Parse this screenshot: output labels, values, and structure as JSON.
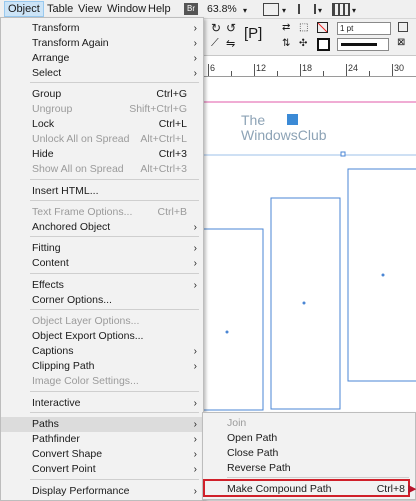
{
  "menubar": {
    "items": [
      "Object",
      "Table",
      "View",
      "Window",
      "Help"
    ],
    "zoom": "63.8%",
    "zoom_br_icon": "Br"
  },
  "controlbar": {
    "ref_label": "[P]",
    "stroke_weight": "1 pt"
  },
  "ruler": {
    "labels": [
      "6",
      "12",
      "18",
      "24",
      "30"
    ]
  },
  "watermark": {
    "line1": "The",
    "line2": "WindowsClub"
  },
  "object_menu": {
    "items": [
      {
        "label": "Transform",
        "shortcut": "",
        "submenu": true,
        "disabled": false
      },
      {
        "label": "Transform Again",
        "shortcut": "",
        "submenu": true,
        "disabled": false
      },
      {
        "label": "Arrange",
        "shortcut": "",
        "submenu": true,
        "disabled": false
      },
      {
        "label": "Select",
        "shortcut": "",
        "submenu": true,
        "disabled": false
      },
      {
        "label": "Group",
        "shortcut": "Ctrl+G",
        "submenu": false,
        "disabled": false
      },
      {
        "label": "Ungroup",
        "shortcut": "Shift+Ctrl+G",
        "submenu": false,
        "disabled": true
      },
      {
        "label": "Lock",
        "shortcut": "Ctrl+L",
        "submenu": false,
        "disabled": false
      },
      {
        "label": "Unlock All on Spread",
        "shortcut": "Alt+Ctrl+L",
        "submenu": false,
        "disabled": true
      },
      {
        "label": "Hide",
        "shortcut": "Ctrl+3",
        "submenu": false,
        "disabled": false
      },
      {
        "label": "Show All on Spread",
        "shortcut": "Alt+Ctrl+3",
        "submenu": false,
        "disabled": true
      },
      {
        "label": "Insert HTML...",
        "shortcut": "",
        "submenu": false,
        "disabled": false
      },
      {
        "label": "Text Frame Options...",
        "shortcut": "Ctrl+B",
        "submenu": false,
        "disabled": true
      },
      {
        "label": "Anchored Object",
        "shortcut": "",
        "submenu": true,
        "disabled": false
      },
      {
        "label": "Fitting",
        "shortcut": "",
        "submenu": true,
        "disabled": false
      },
      {
        "label": "Content",
        "shortcut": "",
        "submenu": true,
        "disabled": false
      },
      {
        "label": "Effects",
        "shortcut": "",
        "submenu": true,
        "disabled": false
      },
      {
        "label": "Corner Options...",
        "shortcut": "",
        "submenu": false,
        "disabled": false
      },
      {
        "label": "Object Layer Options...",
        "shortcut": "",
        "submenu": false,
        "disabled": true
      },
      {
        "label": "Object Export Options...",
        "shortcut": "",
        "submenu": false,
        "disabled": false
      },
      {
        "label": "Captions",
        "shortcut": "",
        "submenu": true,
        "disabled": false
      },
      {
        "label": "Clipping Path",
        "shortcut": "",
        "submenu": true,
        "disabled": false
      },
      {
        "label": "Image Color Settings...",
        "shortcut": "",
        "submenu": false,
        "disabled": true
      },
      {
        "label": "Interactive",
        "shortcut": "",
        "submenu": true,
        "disabled": false
      },
      {
        "label": "Paths",
        "shortcut": "",
        "submenu": true,
        "disabled": false,
        "highlighted": true
      },
      {
        "label": "Pathfinder",
        "shortcut": "",
        "submenu": true,
        "disabled": false
      },
      {
        "label": "Convert Shape",
        "shortcut": "",
        "submenu": true,
        "disabled": false
      },
      {
        "label": "Convert Point",
        "shortcut": "",
        "submenu": true,
        "disabled": false
      },
      {
        "label": "Display Performance",
        "shortcut": "",
        "submenu": true,
        "disabled": false
      }
    ]
  },
  "paths_submenu": {
    "items": [
      {
        "label": "Join",
        "shortcut": "",
        "disabled": true
      },
      {
        "label": "Open Path",
        "shortcut": "",
        "disabled": false
      },
      {
        "label": "Close Path",
        "shortcut": "",
        "disabled": false
      },
      {
        "label": "Reverse Path",
        "shortcut": "",
        "disabled": false
      },
      {
        "label": "Make Compound Path",
        "shortcut": "Ctrl+8",
        "disabled": false,
        "boxed": true
      }
    ]
  },
  "colors": {
    "highlight_box": "#d0202a",
    "frame_blue": "#4a86d4",
    "guide_pink": "#e05aa8"
  }
}
